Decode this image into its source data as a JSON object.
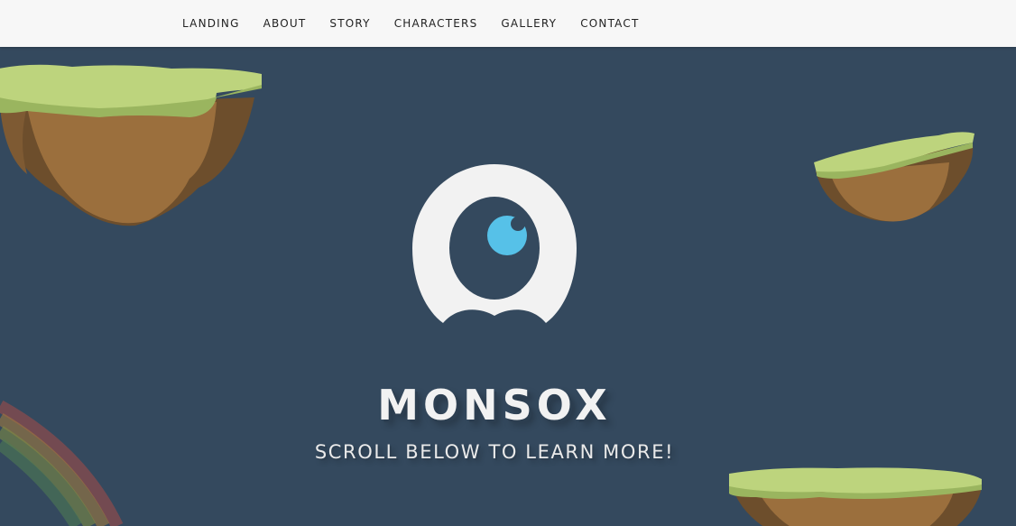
{
  "nav": {
    "items": [
      {
        "label": "LANDING"
      },
      {
        "label": "ABOUT"
      },
      {
        "label": "STORY"
      },
      {
        "label": "CHARACTERS"
      },
      {
        "label": "GALLERY"
      },
      {
        "label": "CONTACT"
      }
    ]
  },
  "hero": {
    "title": "MONSOX",
    "tagline": "SCROLL BELOW TO LEARN MORE!"
  },
  "colors": {
    "background": "#34495e",
    "navbar": "#f7f7f7",
    "grass": "#bdd47d",
    "dirt": "#9b6f3d",
    "dirt_dark": "#6d4e2c",
    "logo": "#f2f2f2",
    "eye": "#56c1e8"
  },
  "icons": {
    "logo": "monsox-eye-logo",
    "islands": "floating-island",
    "rainbow": "rainbow-arc"
  }
}
